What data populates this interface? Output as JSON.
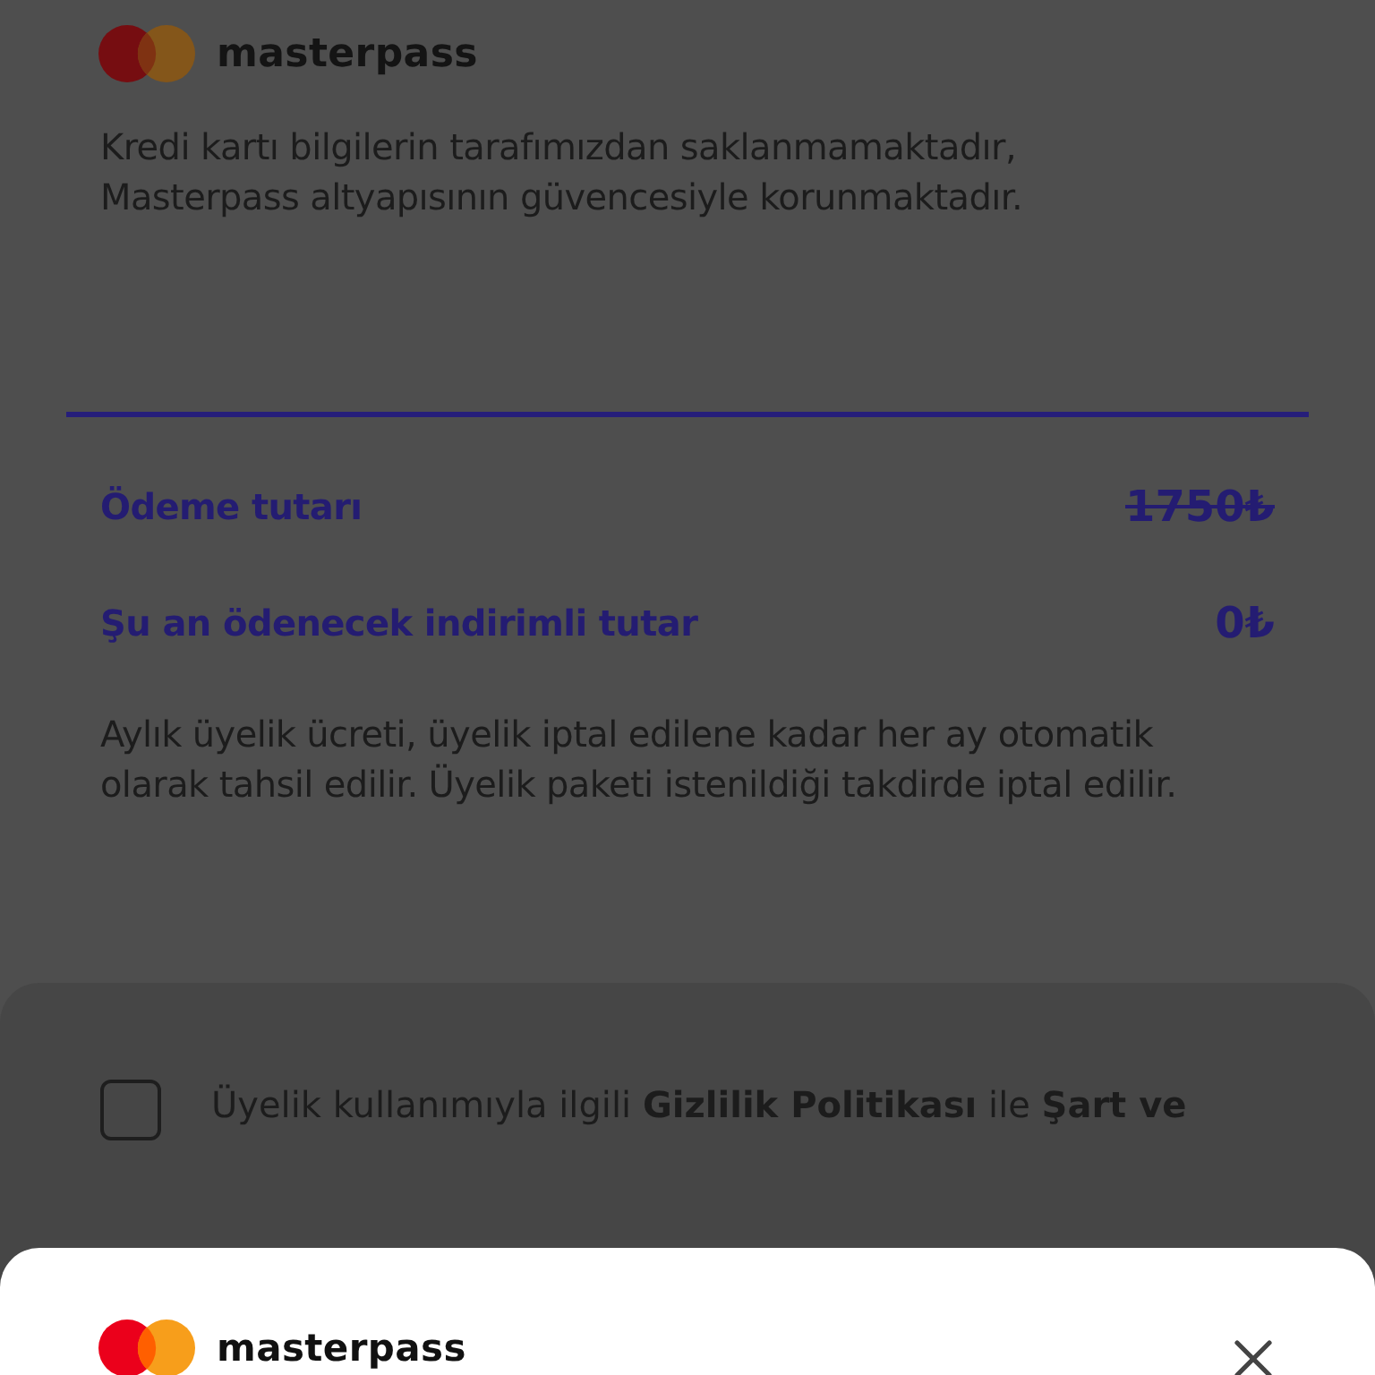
{
  "brand": {
    "name": "masterpass"
  },
  "security_note": "Kredi kartı bilgilerin tarafımızdan saklanmamaktadır, Masterpass altyapısının güvencesiyle korunmaktadır.",
  "amounts": [
    {
      "label": "Ödeme tutarı",
      "value": "1750₺",
      "strikethrough": true
    },
    {
      "label": "Şu an ödenecek indirimli tutar",
      "value": "0₺",
      "strikethrough": false
    }
  ],
  "billing_note": "Aylık üyelik ücreti, üyelik iptal edilene kadar her ay otomatik olarak tahsil edilir. Üyelik paketi istenildiği takdirde iptal edilir.",
  "consent": {
    "text": "Üyelik kullanımıyla ilgili **Gizlilik Politikası** ile **Şart ve**",
    "checked": false
  },
  "sheet": {
    "brand": "masterpass"
  }
}
